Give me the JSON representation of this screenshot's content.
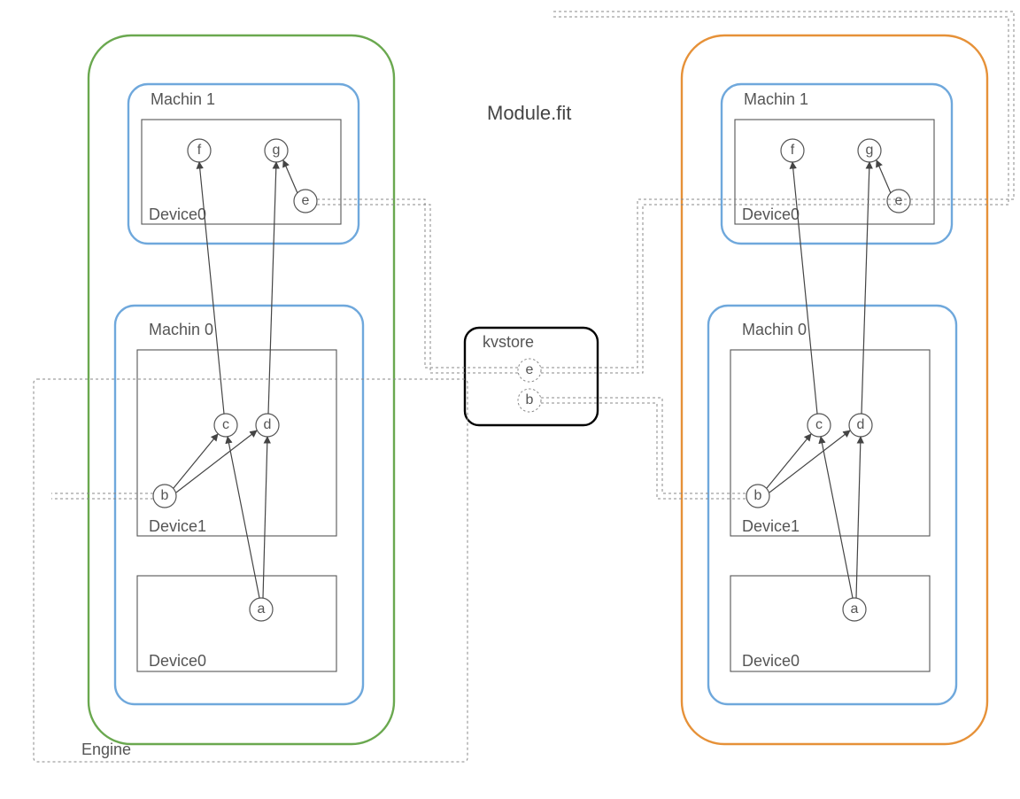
{
  "title": "Module.fit",
  "kvstore_label": "kvstore",
  "engine_label": "Engine",
  "kv_nodes": {
    "e": "e",
    "b": "b"
  },
  "left": {
    "color": "green",
    "m1": {
      "label": "Machin 1",
      "device": "Device0",
      "nodes": {
        "f": "f",
        "g": "g",
        "e": "e"
      }
    },
    "m0": {
      "label": "Machin 0",
      "d1": {
        "label": "Device1",
        "nodes": {
          "b": "b",
          "c": "c",
          "d": "d"
        }
      },
      "d0": {
        "label": "Device0",
        "nodes": {
          "a": "a"
        }
      }
    }
  },
  "right": {
    "color": "orange",
    "m1": {
      "label": "Machin 1",
      "device": "Device0",
      "nodes": {
        "f": "f",
        "g": "g",
        "e": "e"
      }
    },
    "m0": {
      "label": "Machin 0",
      "d1": {
        "label": "Device1",
        "nodes": {
          "b": "b",
          "c": "c",
          "d": "d"
        }
      },
      "d0": {
        "label": "Device0",
        "nodes": {
          "a": "a"
        }
      }
    }
  }
}
